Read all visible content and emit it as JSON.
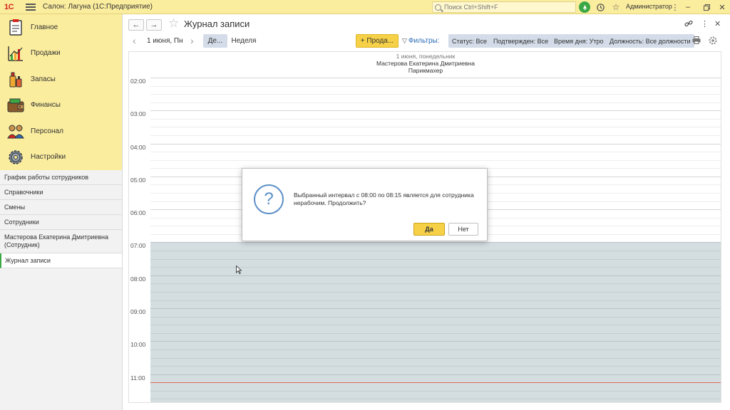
{
  "topbar": {
    "logo": "1С",
    "app_title": "Салон: Лагуна  (1С:Предприятие)",
    "search_placeholder": "Поиск Ctrl+Shift+F",
    "user": "Администратор"
  },
  "sidebar": {
    "sections": [
      {
        "label": "Главное",
        "icon": "clipboard-icon"
      },
      {
        "label": "Продажи",
        "icon": "sales-chart-icon"
      },
      {
        "label": "Запасы",
        "icon": "stock-bottles-icon"
      },
      {
        "label": "Финансы",
        "icon": "wallet-icon"
      },
      {
        "label": "Персонал",
        "icon": "staff-icon"
      },
      {
        "label": "Настройки",
        "icon": "gear-icon"
      }
    ],
    "nav": [
      "График работы сотрудников",
      "Справочники",
      "Смены",
      "Сотрудники",
      "Мастерова Екатерина Дмитриевна (Сотрудник)",
      "Журнал записи"
    ]
  },
  "page": {
    "title": "Журнал записи"
  },
  "toolbar": {
    "date": "1 июня, Пн",
    "day_label": "Де...",
    "week_label": "Неделя",
    "add_label": "+ Прода...",
    "filters_label": "Фильтры:",
    "chips": [
      "Статус: Все",
      "Подтвержден: Все",
      "Время дня: Утро",
      "Должность: Все должности"
    ]
  },
  "calendar": {
    "date": "1 июня, понедельник",
    "employee": "Мастерова Екатерина Дмитриевна",
    "position": "Парикмахер",
    "hours": [
      "02:00",
      "03:00",
      "04:00",
      "05:00",
      "06:00",
      "07:00",
      "08:00",
      "09:00",
      "10:00",
      "11:00"
    ]
  },
  "dialog": {
    "message": "Выбранный интервал с 08:00 по 08:15 является для сотрудника нерабочим. Продолжить?",
    "yes": "Да",
    "no": "Нет"
  },
  "colors": {
    "accent": "#f6d147",
    "panel": "#fbed9e",
    "green": "#3ba845",
    "link": "#2a6ab5",
    "offhours": "#d4dde0"
  }
}
